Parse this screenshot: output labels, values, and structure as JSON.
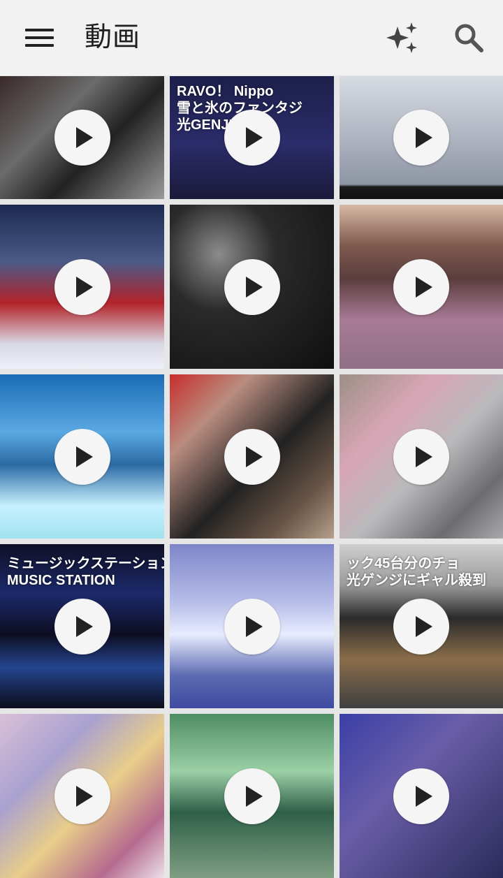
{
  "appbar": {
    "title": "動画",
    "menu_icon": "hamburger-menu-icon",
    "sparkle_icon": "sparkle-icon",
    "search_icon": "search-icon"
  },
  "grid": {
    "videos": [
      {
        "overlay": "",
        "bg": "linear-gradient(135deg,#3a2a2a 0%,#6b6b6b 35%,#222 60%,#9a9a9a 100%)"
      },
      {
        "overlay": "RAVO！ Nippo\n雪と氷のファンタジ\n光GENJI",
        "bg": "linear-gradient(180deg,#1d1f4a 0%,#2b2c6a 55%,#1b1a3a 100%)"
      },
      {
        "overlay": "",
        "bg": "linear-gradient(180deg,#d7dbe2 0%,#aeb4c0 50%,#8e95a3 88%,#1a1a1a 90%,#111 100%)"
      },
      {
        "overlay": "",
        "bg": "linear-gradient(180deg,#1c2a52 0%,#4b5a86 35%,#b3232a 60%,#d9d9e6 85%,#eef0f8 100%)"
      },
      {
        "overlay": "",
        "bg": "radial-gradient(circle at 30% 30%,#8c8c8c 0%,#2a2a2a 35%,#0f0f0f 100%)"
      },
      {
        "overlay": "",
        "bg": "linear-gradient(180deg,#d6b9a4 0%,#7f5a4e 25%,#5a3d3d 45%,#a77a95 70%,#8f6f86 100%)"
      },
      {
        "overlay": "",
        "bg": "linear-gradient(180deg,#1a6bb5 0%,#5ba9e3 35%,#2b6aa3 55%,#c7f0ff 80%,#9fe2f0 100%)"
      },
      {
        "overlay": "",
        "bg": "linear-gradient(135deg,#c92d2d 0%,#b98d7f 25%,#222 55%,#6a5547 80%,#b6a08c 100%)"
      },
      {
        "overlay": "",
        "bg": "linear-gradient(135deg,#9c8f86 0%,#d8a6b6 30%,#b9b9bb 55%,#6c6c6f 80%,#a9a8ad 100%)"
      },
      {
        "overlay": "ミュージックステーション\nMUSIC STATION",
        "bg": "linear-gradient(180deg,#0f0f25 0%,#1c2a6b 30%,#0d0d22 55%,#24458f 75%,#0c0c1a 100%)"
      },
      {
        "overlay": "",
        "bg": "linear-gradient(180deg,#7e86c9 0%,#b6bde8 35%,#e8ecff 55%,#5c6bb2 80%,#3e4aa0 100%)"
      },
      {
        "overlay": "ック45台分のチョ\n光ゲンジにギャル殺到",
        "bg": "linear-gradient(180deg,#cfcfcf 0%,#9a9a9a 25%,#2b2b2b 45%,#8a6d4a 70%,#3f3f3f 100%)"
      },
      {
        "overlay": "",
        "bg": "linear-gradient(135deg,#d9c0d8 0%,#a9a1cf 30%,#e8cd8a 55%,#b56a8e 80%,#ece0e8 100%)"
      },
      {
        "overlay": "",
        "bg": "linear-gradient(180deg,#4f8d63 0%,#9bd0a5 35%,#2f5f48 60%,#7f9f83 100%)"
      },
      {
        "overlay": "",
        "bg": "linear-gradient(135deg,#3a3fa6 0%,#6a5ea8 40%,#2a2a5a 100%)"
      }
    ]
  }
}
